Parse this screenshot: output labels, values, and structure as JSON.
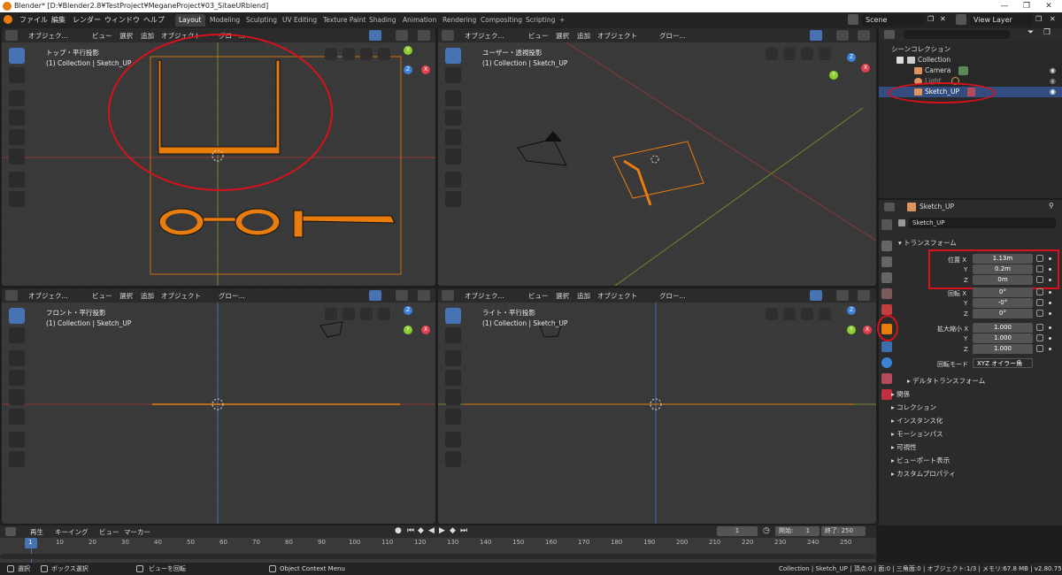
{
  "window": {
    "title": "Blender* [D:¥Blender2.8¥TestProject¥MeganeProject¥03_SitaeURblend]",
    "minimize": "—",
    "maximize": "❐",
    "close": "✕"
  },
  "menu": {
    "items": [
      "ファイル",
      "編集",
      "レンダー",
      "ウィンドウ",
      "ヘルプ"
    ]
  },
  "workspace_tabs": [
    "Layout",
    "Modeling",
    "Sculpting",
    "UV Editing",
    "Texture Paint",
    "Shading",
    "Animation",
    "Rendering",
    "Compositing",
    "Scripting",
    "+"
  ],
  "scene": {
    "label": "Scene",
    "view_layer": "View Layer"
  },
  "viewport_header": {
    "mode": "オブジェク...",
    "view": "ビュー",
    "select": "選択",
    "add": "追加",
    "object": "オブジェクト",
    "transform": "グロー..."
  },
  "viewports": {
    "top": {
      "title": "トップ・平行投影",
      "subtitle": "(1) Collection | Sketch_UP"
    },
    "user": {
      "title": "ユーザー・透視投影",
      "subtitle": "(1) Collection | Sketch_UP"
    },
    "front": {
      "title": "フロント・平行投影",
      "subtitle": "(1) Collection | Sketch_UP"
    },
    "right": {
      "title": "ライト・平行投影",
      "subtitle": "(1) Collection | Sketch_UP"
    }
  },
  "gizmo": {
    "x": "X",
    "y": "Y",
    "z": "Z"
  },
  "outliner": {
    "root": "シーンコレクション",
    "items": [
      {
        "label": "Collection"
      },
      {
        "label": "Camera"
      },
      {
        "label": "Light"
      },
      {
        "label": "Sketch_UP"
      }
    ]
  },
  "properties": {
    "object_name": "Sketch_UP",
    "panel_name": "Sketch_UP",
    "transform_section": "トランスフォーム",
    "location_label": "位置 X",
    "location": {
      "x": "1.13m",
      "y": "0.2m",
      "z": "0m"
    },
    "rotation_label": "回転 X",
    "rotation": {
      "x": "0°",
      "y": "-0°",
      "z": "0°"
    },
    "scale_label": "拡大縮小 X",
    "scale": {
      "x": "1.000",
      "y": "1.000",
      "z": "1.000"
    },
    "axis_y": "Y",
    "axis_z": "Z",
    "rotation_mode_label": "回転モード",
    "rotation_mode_value": "XYZ オイラー角",
    "delta_section": "デルタトランスフォーム",
    "sections": [
      "関係",
      "コレクション",
      "インスタンス化",
      "モーションパス",
      "可視性",
      "ビューポート表示",
      "カスタムプロパティ"
    ]
  },
  "timeline": {
    "menu": [
      "再生",
      "キーイング",
      "ビュー",
      "マーカー"
    ],
    "current_frame": "1",
    "start_label": "開始:",
    "start": "1",
    "end_label": "終了:",
    "end": "250",
    "ruler": [
      "1",
      "10",
      "20",
      "30",
      "40",
      "50",
      "60",
      "70",
      "80",
      "90",
      "100",
      "110",
      "120",
      "130",
      "140",
      "150",
      "160",
      "170",
      "180",
      "190",
      "200",
      "210",
      "220",
      "230",
      "240",
      "250"
    ]
  },
  "status": {
    "select": "選択",
    "box_select": "ボックス選択",
    "rotate_view": "ビューを回転",
    "context_menu": "Object Context Menu",
    "info": "Collection | Sketch_UP | 頂点:0 | 面:0 | 三角面:0 | オブジェクト:1/3 | メモリ:67.8 MB | v2.80.75"
  },
  "colors": {
    "accent": "#4772b3",
    "selection": "#e87d0d",
    "annotation": "#d7121b",
    "axis_x": "#e04050",
    "axis_y": "#8ccf2e",
    "axis_z": "#3d82d9"
  }
}
